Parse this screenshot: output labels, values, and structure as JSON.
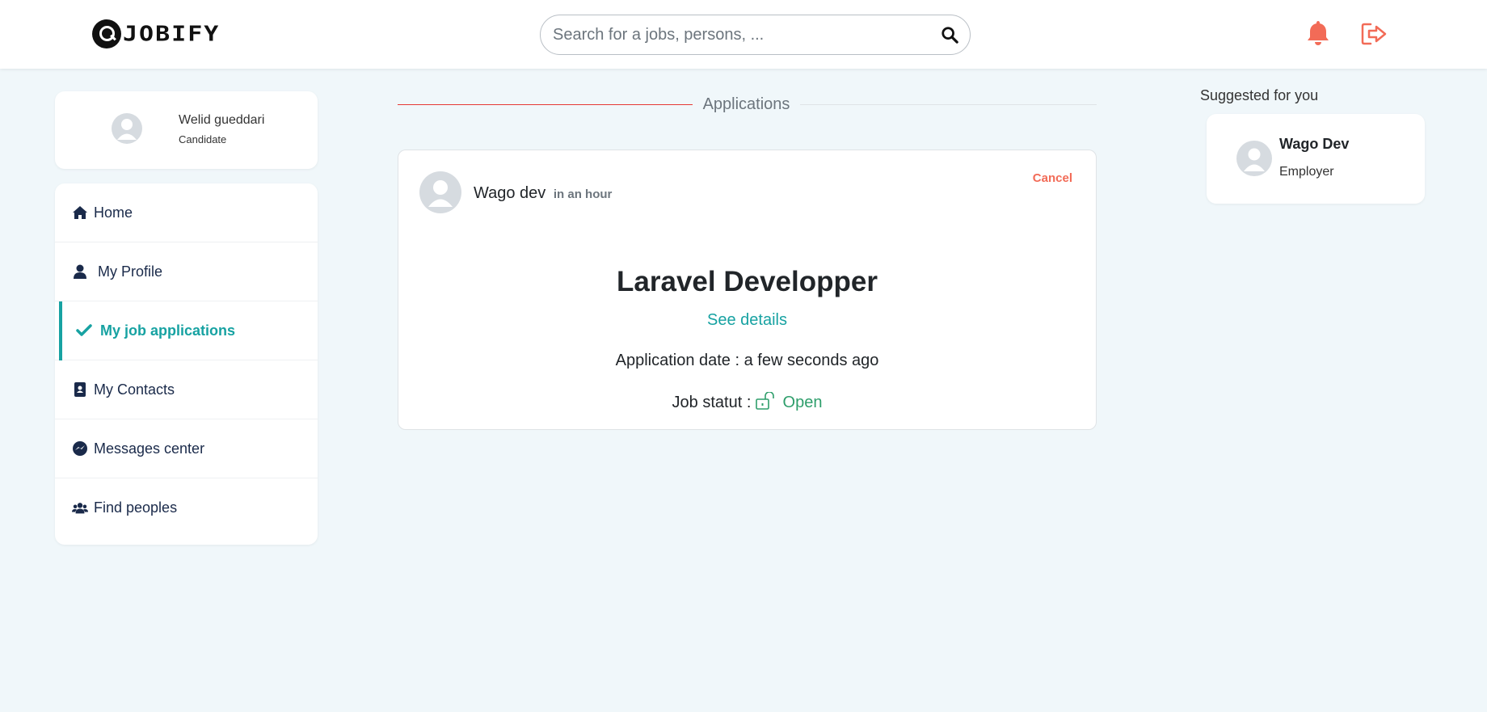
{
  "brand": {
    "name": "JOBIFY"
  },
  "header": {
    "search_placeholder": "Search for a jobs, persons, ...",
    "accent_color": "#f26b57"
  },
  "profile": {
    "name": "Welid gueddari",
    "role": "Candidate"
  },
  "nav": {
    "items": [
      {
        "label": "Home",
        "icon": "home-icon"
      },
      {
        "label": "My Profile",
        "icon": "user-icon"
      },
      {
        "label": "My job applications",
        "icon": "check-icon",
        "active": true
      },
      {
        "label": "My Contacts",
        "icon": "address-book-icon"
      },
      {
        "label": "Messages center",
        "icon": "messenger-icon"
      },
      {
        "label": "Find peoples",
        "icon": "users-icon"
      }
    ]
  },
  "main": {
    "section_title": "Applications",
    "application": {
      "employer_name": "Wago dev",
      "time": "in an hour",
      "cancel_label": "Cancel",
      "job_title": "Laravel Developper",
      "details_link": "See details",
      "application_date": "Application date : a few seconds ago",
      "status_label": "Job statut :",
      "status_value": "Open"
    }
  },
  "suggestions": {
    "title": "Suggested for you",
    "items": [
      {
        "name": "Wago Dev",
        "role": "Employer"
      }
    ]
  },
  "colors": {
    "teal": "#17a2a2",
    "cancel": "#f26b57",
    "open_status": "#2e9e6b",
    "divider_red": "#e53935"
  }
}
